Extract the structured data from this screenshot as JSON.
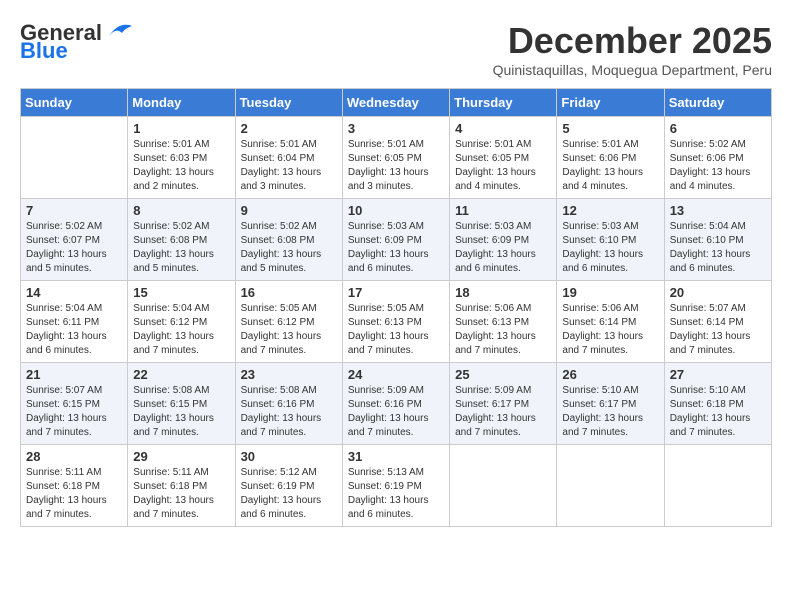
{
  "header": {
    "logo_general": "General",
    "logo_blue": "Blue",
    "month_year": "December 2025",
    "location": "Quinistaquillas, Moquegua Department, Peru"
  },
  "days_of_week": [
    "Sunday",
    "Monday",
    "Tuesday",
    "Wednesday",
    "Thursday",
    "Friday",
    "Saturday"
  ],
  "weeks": [
    [
      {
        "day": "",
        "info": ""
      },
      {
        "day": "1",
        "info": "Sunrise: 5:01 AM\nSunset: 6:03 PM\nDaylight: 13 hours\nand 2 minutes."
      },
      {
        "day": "2",
        "info": "Sunrise: 5:01 AM\nSunset: 6:04 PM\nDaylight: 13 hours\nand 3 minutes."
      },
      {
        "day": "3",
        "info": "Sunrise: 5:01 AM\nSunset: 6:05 PM\nDaylight: 13 hours\nand 3 minutes."
      },
      {
        "day": "4",
        "info": "Sunrise: 5:01 AM\nSunset: 6:05 PM\nDaylight: 13 hours\nand 4 minutes."
      },
      {
        "day": "5",
        "info": "Sunrise: 5:01 AM\nSunset: 6:06 PM\nDaylight: 13 hours\nand 4 minutes."
      },
      {
        "day": "6",
        "info": "Sunrise: 5:02 AM\nSunset: 6:06 PM\nDaylight: 13 hours\nand 4 minutes."
      }
    ],
    [
      {
        "day": "7",
        "info": "Sunrise: 5:02 AM\nSunset: 6:07 PM\nDaylight: 13 hours\nand 5 minutes."
      },
      {
        "day": "8",
        "info": "Sunrise: 5:02 AM\nSunset: 6:08 PM\nDaylight: 13 hours\nand 5 minutes."
      },
      {
        "day": "9",
        "info": "Sunrise: 5:02 AM\nSunset: 6:08 PM\nDaylight: 13 hours\nand 5 minutes."
      },
      {
        "day": "10",
        "info": "Sunrise: 5:03 AM\nSunset: 6:09 PM\nDaylight: 13 hours\nand 6 minutes."
      },
      {
        "day": "11",
        "info": "Sunrise: 5:03 AM\nSunset: 6:09 PM\nDaylight: 13 hours\nand 6 minutes."
      },
      {
        "day": "12",
        "info": "Sunrise: 5:03 AM\nSunset: 6:10 PM\nDaylight: 13 hours\nand 6 minutes."
      },
      {
        "day": "13",
        "info": "Sunrise: 5:04 AM\nSunset: 6:10 PM\nDaylight: 13 hours\nand 6 minutes."
      }
    ],
    [
      {
        "day": "14",
        "info": "Sunrise: 5:04 AM\nSunset: 6:11 PM\nDaylight: 13 hours\nand 6 minutes."
      },
      {
        "day": "15",
        "info": "Sunrise: 5:04 AM\nSunset: 6:12 PM\nDaylight: 13 hours\nand 7 minutes."
      },
      {
        "day": "16",
        "info": "Sunrise: 5:05 AM\nSunset: 6:12 PM\nDaylight: 13 hours\nand 7 minutes."
      },
      {
        "day": "17",
        "info": "Sunrise: 5:05 AM\nSunset: 6:13 PM\nDaylight: 13 hours\nand 7 minutes."
      },
      {
        "day": "18",
        "info": "Sunrise: 5:06 AM\nSunset: 6:13 PM\nDaylight: 13 hours\nand 7 minutes."
      },
      {
        "day": "19",
        "info": "Sunrise: 5:06 AM\nSunset: 6:14 PM\nDaylight: 13 hours\nand 7 minutes."
      },
      {
        "day": "20",
        "info": "Sunrise: 5:07 AM\nSunset: 6:14 PM\nDaylight: 13 hours\nand 7 minutes."
      }
    ],
    [
      {
        "day": "21",
        "info": "Sunrise: 5:07 AM\nSunset: 6:15 PM\nDaylight: 13 hours\nand 7 minutes."
      },
      {
        "day": "22",
        "info": "Sunrise: 5:08 AM\nSunset: 6:15 PM\nDaylight: 13 hours\nand 7 minutes."
      },
      {
        "day": "23",
        "info": "Sunrise: 5:08 AM\nSunset: 6:16 PM\nDaylight: 13 hours\nand 7 minutes."
      },
      {
        "day": "24",
        "info": "Sunrise: 5:09 AM\nSunset: 6:16 PM\nDaylight: 13 hours\nand 7 minutes."
      },
      {
        "day": "25",
        "info": "Sunrise: 5:09 AM\nSunset: 6:17 PM\nDaylight: 13 hours\nand 7 minutes."
      },
      {
        "day": "26",
        "info": "Sunrise: 5:10 AM\nSunset: 6:17 PM\nDaylight: 13 hours\nand 7 minutes."
      },
      {
        "day": "27",
        "info": "Sunrise: 5:10 AM\nSunset: 6:18 PM\nDaylight: 13 hours\nand 7 minutes."
      }
    ],
    [
      {
        "day": "28",
        "info": "Sunrise: 5:11 AM\nSunset: 6:18 PM\nDaylight: 13 hours\nand 7 minutes."
      },
      {
        "day": "29",
        "info": "Sunrise: 5:11 AM\nSunset: 6:18 PM\nDaylight: 13 hours\nand 7 minutes."
      },
      {
        "day": "30",
        "info": "Sunrise: 5:12 AM\nSunset: 6:19 PM\nDaylight: 13 hours\nand 6 minutes."
      },
      {
        "day": "31",
        "info": "Sunrise: 5:13 AM\nSunset: 6:19 PM\nDaylight: 13 hours\nand 6 minutes."
      },
      {
        "day": "",
        "info": ""
      },
      {
        "day": "",
        "info": ""
      },
      {
        "day": "",
        "info": ""
      }
    ]
  ]
}
